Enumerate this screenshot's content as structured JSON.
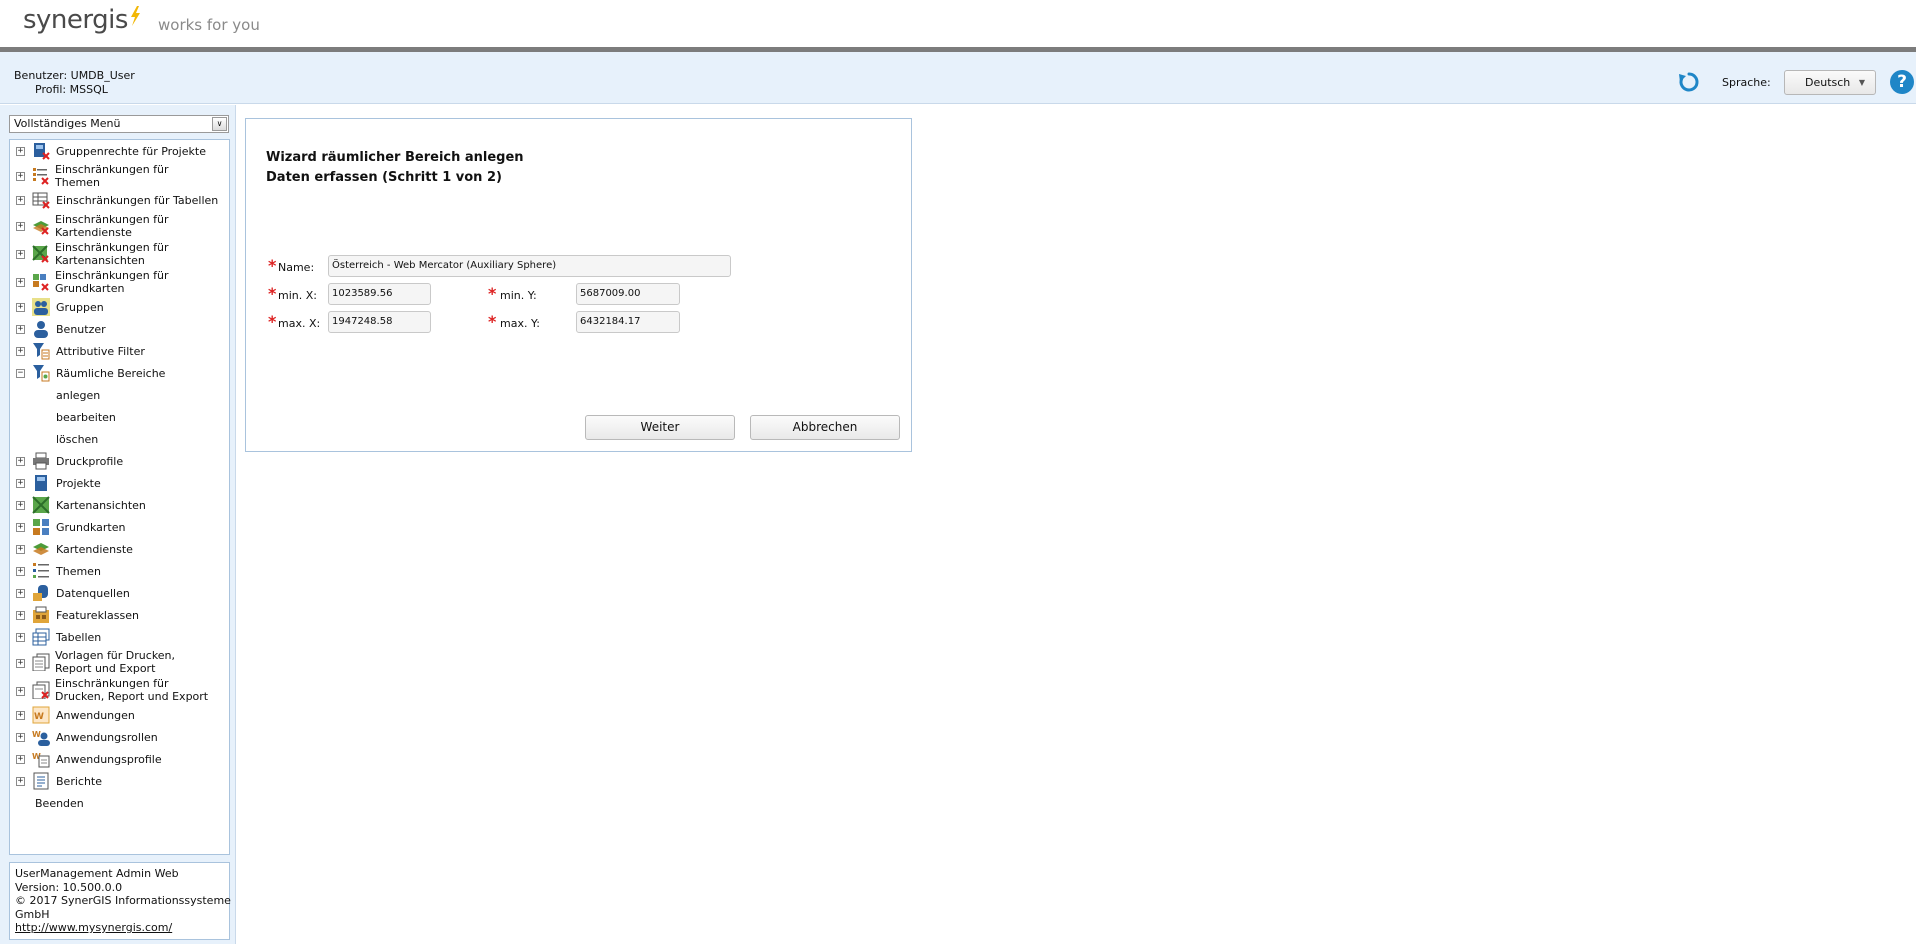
{
  "brand": {
    "logo": "synergis",
    "tagline": "works for you"
  },
  "userbar": {
    "user_line": "Benutzer: UMDB_User",
    "profile_line": "Profil: MSSQL",
    "language_label": "Sprache:",
    "language_value": "Deutsch",
    "help": "?"
  },
  "sidebar": {
    "menu_select": "Vollständiges Menü",
    "items": [
      {
        "label": "Gruppenrechte für Projekte",
        "icon": "project-rights-icon"
      },
      {
        "label": "Einschränkungen für\nThemen",
        "icon": "theme-restrictions-icon"
      },
      {
        "label": "Einschränkungen für Tabellen",
        "icon": "table-restrictions-icon"
      },
      {
        "label": "Einschränkungen für\nKartendienste",
        "icon": "mapservice-restrictions-icon"
      },
      {
        "label": "Einschränkungen für\nKartenansichten",
        "icon": "mapview-restrictions-icon"
      },
      {
        "label": "Einschränkungen für\nGrundkarten",
        "icon": "basemap-restrictions-icon"
      },
      {
        "label": "Gruppen",
        "icon": "groups-icon"
      },
      {
        "label": "Benutzer",
        "icon": "user-icon"
      },
      {
        "label": "Attributive Filter",
        "icon": "attribute-filter-icon"
      },
      {
        "label": "Räumliche Bereiche",
        "icon": "spatial-filter-icon"
      },
      {
        "label": "Druckprofile",
        "icon": "printer-icon"
      },
      {
        "label": "Projekte",
        "icon": "project-icon"
      },
      {
        "label": "Kartenansichten",
        "icon": "mapview-icon"
      },
      {
        "label": "Grundkarten",
        "icon": "basemap-icon"
      },
      {
        "label": "Kartendienste",
        "icon": "mapservice-icon"
      },
      {
        "label": "Themen",
        "icon": "theme-icon"
      },
      {
        "label": "Datenquellen",
        "icon": "datasource-icon"
      },
      {
        "label": "Featureklassen",
        "icon": "featureclass-icon"
      },
      {
        "label": "Tabellen",
        "icon": "table-icon"
      },
      {
        "label": "Vorlagen für Drucken,\nReport und Export",
        "icon": "template-icon"
      },
      {
        "label": "Einschränkungen für\nDrucken, Report und Export",
        "icon": "template-restrictions-icon"
      },
      {
        "label": "Anwendungen",
        "icon": "application-icon"
      },
      {
        "label": "Anwendungsrollen",
        "icon": "application-roles-icon"
      },
      {
        "label": "Anwendungsprofile",
        "icon": "application-profiles-icon"
      },
      {
        "label": "Berichte",
        "icon": "report-icon"
      }
    ],
    "children": [
      "anlegen",
      "bearbeiten",
      "löschen"
    ],
    "exit": "Beenden",
    "info": {
      "line1": "UserManagement Admin Web",
      "line2": "Version: 10.500.0.0",
      "line3": "© 2017 SynerGIS Informationssysteme",
      "line4": "GmbH",
      "link": "http://www.mysynergis.com/"
    }
  },
  "wizard": {
    "title": "Wizard räumlicher Bereich anlegen",
    "subtitle": "Daten erfassen (Schritt 1 von 2)",
    "name_label": "Name:",
    "name_value": "Österreich - Web Mercator (Auxiliary Sphere)",
    "minx_label": "min. X:",
    "minx_value": "1023589.56",
    "miny_label": "min. Y:",
    "miny_value": "5687009.00",
    "maxx_label": "max. X:",
    "maxx_value": "1947248.58",
    "maxy_label": "max. Y:",
    "maxy_value": "6432184.17",
    "next_label": "Weiter",
    "cancel_label": "Abbrechen"
  },
  "colors": {
    "accent_blue": "#1f86c7",
    "required_red": "#dd2222",
    "panel_bg": "#e7f1fb",
    "logo_flash": "#f2b705"
  }
}
